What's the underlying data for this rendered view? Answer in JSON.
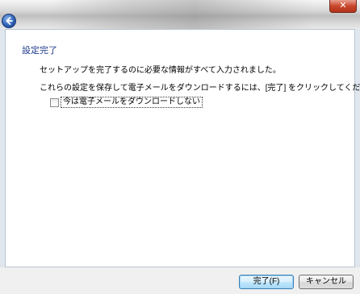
{
  "window": {
    "close_symbol": "✕",
    "back_icon": "back-arrow-icon"
  },
  "content": {
    "heading": "設定完了",
    "message_1": "セットアップを完了するのに必要な情報がすべて入力されました。",
    "message_2": "これらの設定を保存して電子メールをダウンロードするには、[完了] をクリックしてください。",
    "checkbox": {
      "label": "今は電子メールをダウンロードしない",
      "checked": false
    }
  },
  "footer": {
    "finish_label": "完了(F)",
    "cancel_label": "キャンセル"
  }
}
